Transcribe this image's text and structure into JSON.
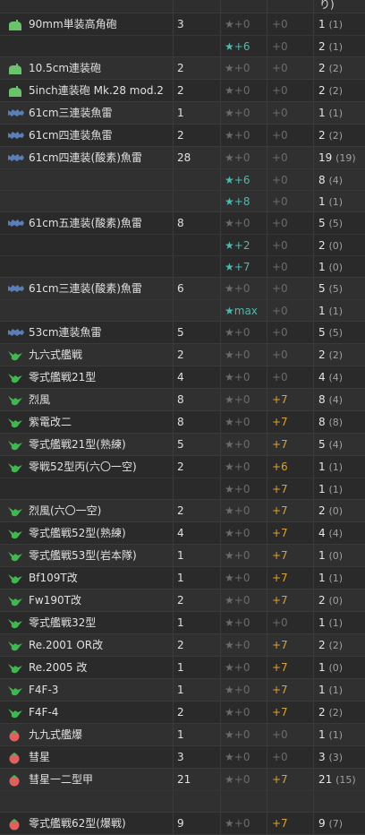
{
  "header": {
    "count_label": "り)"
  },
  "colors": {
    "aa_gun_icon": "#6cc26c",
    "torpedo_icon": "#5a7fb8",
    "fighter_icon": "#3fb84f",
    "bomber_icon": "#e06060",
    "improvement_star": "#4fb8b0",
    "proficiency": "#e0a22a",
    "zero_value": "#6b6b6b"
  },
  "rows": [
    {
      "icon": "aa-gun",
      "name": "90mm単装高角砲",
      "count": "3",
      "entries": [
        {
          "star": "★+0",
          "prof": "+0",
          "total": "1",
          "parenthesized": "(1)"
        },
        {
          "star": "★+6",
          "prof": "+0",
          "total": "2",
          "parenthesized": "(1)"
        }
      ]
    },
    {
      "icon": "aa-gun",
      "name": "10.5cm連装砲",
      "count": "2",
      "entries": [
        {
          "star": "★+0",
          "prof": "+0",
          "total": "2",
          "parenthesized": "(2)"
        }
      ]
    },
    {
      "icon": "aa-gun",
      "name": "5inch連装砲 Mk.28 mod.2",
      "count": "2",
      "entries": [
        {
          "star": "★+0",
          "prof": "+0",
          "total": "2",
          "parenthesized": "(2)"
        }
      ]
    },
    {
      "icon": "torpedo",
      "name": "61cm三連装魚雷",
      "count": "1",
      "entries": [
        {
          "star": "★+0",
          "prof": "+0",
          "total": "1",
          "parenthesized": "(1)"
        }
      ]
    },
    {
      "icon": "torpedo",
      "name": "61cm四連装魚雷",
      "count": "2",
      "entries": [
        {
          "star": "★+0",
          "prof": "+0",
          "total": "2",
          "parenthesized": "(2)"
        }
      ]
    },
    {
      "icon": "torpedo",
      "name": "61cm四連装(酸素)魚雷",
      "count": "28",
      "entries": [
        {
          "star": "★+0",
          "prof": "+0",
          "total": "19",
          "parenthesized": "(19)"
        },
        {
          "star": "★+6",
          "prof": "+0",
          "total": "8",
          "parenthesized": "(4)"
        },
        {
          "star": "★+8",
          "prof": "+0",
          "total": "1",
          "parenthesized": "(1)"
        }
      ]
    },
    {
      "icon": "torpedo",
      "name": "61cm五連装(酸素)魚雷",
      "count": "8",
      "entries": [
        {
          "star": "★+0",
          "prof": "+0",
          "total": "5",
          "parenthesized": "(5)"
        },
        {
          "star": "★+2",
          "prof": "+0",
          "total": "2",
          "parenthesized": "(0)"
        },
        {
          "star": "★+7",
          "prof": "+0",
          "total": "1",
          "parenthesized": "(0)"
        }
      ]
    },
    {
      "icon": "torpedo",
      "name": "61cm三連装(酸素)魚雷",
      "count": "6",
      "entries": [
        {
          "star": "★+0",
          "prof": "+0",
          "total": "5",
          "parenthesized": "(5)"
        },
        {
          "star": "★max",
          "prof": "+0",
          "total": "1",
          "parenthesized": "(1)"
        }
      ]
    },
    {
      "icon": "torpedo",
      "name": "53cm連装魚雷",
      "count": "5",
      "entries": [
        {
          "star": "★+0",
          "prof": "+0",
          "total": "5",
          "parenthesized": "(5)"
        }
      ]
    },
    {
      "icon": "fighter",
      "name": "九六式艦戦",
      "count": "2",
      "entries": [
        {
          "star": "★+0",
          "prof": "+0",
          "total": "2",
          "parenthesized": "(2)"
        }
      ]
    },
    {
      "icon": "fighter",
      "name": "零式艦戦21型",
      "count": "4",
      "entries": [
        {
          "star": "★+0",
          "prof": "+0",
          "total": "4",
          "parenthesized": "(4)"
        }
      ]
    },
    {
      "icon": "fighter",
      "name": "烈風",
      "count": "8",
      "entries": [
        {
          "star": "★+0",
          "prof": "+7",
          "total": "8",
          "parenthesized": "(4)"
        }
      ]
    },
    {
      "icon": "fighter",
      "name": "紫電改二",
      "count": "8",
      "entries": [
        {
          "star": "★+0",
          "prof": "+7",
          "total": "8",
          "parenthesized": "(8)"
        }
      ]
    },
    {
      "icon": "fighter",
      "name": "零式艦戦21型(熟練)",
      "count": "5",
      "entries": [
        {
          "star": "★+0",
          "prof": "+7",
          "total": "5",
          "parenthesized": "(4)"
        }
      ]
    },
    {
      "icon": "fighter",
      "name": "零戦52型丙(六〇一空)",
      "count": "2",
      "entries": [
        {
          "star": "★+0",
          "prof": "+6",
          "total": "1",
          "parenthesized": "(1)"
        },
        {
          "star": "★+0",
          "prof": "+7",
          "total": "1",
          "parenthesized": "(1)"
        }
      ]
    },
    {
      "icon": "fighter",
      "name": "烈風(六〇一空)",
      "count": "2",
      "entries": [
        {
          "star": "★+0",
          "prof": "+7",
          "total": "2",
          "parenthesized": "(0)"
        }
      ]
    },
    {
      "icon": "fighter",
      "name": "零式艦戦52型(熟練)",
      "count": "4",
      "entries": [
        {
          "star": "★+0",
          "prof": "+7",
          "total": "4",
          "parenthesized": "(4)"
        }
      ]
    },
    {
      "icon": "fighter",
      "name": "零式艦戦53型(岩本隊)",
      "count": "1",
      "entries": [
        {
          "star": "★+0",
          "prof": "+7",
          "total": "1",
          "parenthesized": "(0)"
        }
      ]
    },
    {
      "icon": "fighter",
      "name": "Bf109T改",
      "count": "1",
      "entries": [
        {
          "star": "★+0",
          "prof": "+7",
          "total": "1",
          "parenthesized": "(1)"
        }
      ]
    },
    {
      "icon": "fighter",
      "name": "Fw190T改",
      "count": "2",
      "entries": [
        {
          "star": "★+0",
          "prof": "+7",
          "total": "2",
          "parenthesized": "(0)"
        }
      ]
    },
    {
      "icon": "fighter",
      "name": "零式艦戦32型",
      "count": "1",
      "entries": [
        {
          "star": "★+0",
          "prof": "+0",
          "total": "1",
          "parenthesized": "(1)"
        }
      ]
    },
    {
      "icon": "fighter",
      "name": "Re.2001 OR改",
      "count": "2",
      "entries": [
        {
          "star": "★+0",
          "prof": "+7",
          "total": "2",
          "parenthesized": "(2)"
        }
      ]
    },
    {
      "icon": "fighter",
      "name": "Re.2005 改",
      "count": "1",
      "entries": [
        {
          "star": "★+0",
          "prof": "+7",
          "total": "1",
          "parenthesized": "(0)"
        }
      ]
    },
    {
      "icon": "fighter",
      "name": "F4F-3",
      "count": "1",
      "entries": [
        {
          "star": "★+0",
          "prof": "+7",
          "total": "1",
          "parenthesized": "(1)"
        }
      ]
    },
    {
      "icon": "fighter",
      "name": "F4F-4",
      "count": "2",
      "entries": [
        {
          "star": "★+0",
          "prof": "+7",
          "total": "2",
          "parenthesized": "(2)"
        }
      ]
    },
    {
      "icon": "bomber",
      "name": "九九式艦爆",
      "count": "1",
      "entries": [
        {
          "star": "★+0",
          "prof": "+0",
          "total": "1",
          "parenthesized": "(1)"
        }
      ]
    },
    {
      "icon": "bomber",
      "name": "彗星",
      "count": "3",
      "entries": [
        {
          "star": "★+0",
          "prof": "+0",
          "total": "3",
          "parenthesized": "(3)"
        }
      ]
    },
    {
      "icon": "bomber",
      "name": "彗星一二型甲",
      "count": "21",
      "entries": [
        {
          "star": "★+0",
          "prof": "+7",
          "total": "21",
          "parenthesized": "(15)"
        },
        {
          "star": "",
          "prof": "",
          "total": "",
          "parenthesized": ""
        }
      ]
    },
    {
      "icon": "bomber",
      "name": "零式艦戦62型(爆戦)",
      "count": "9",
      "entries": [
        {
          "star": "★+0",
          "prof": "+7",
          "total": "9",
          "parenthesized": "(7)"
        }
      ]
    }
  ]
}
